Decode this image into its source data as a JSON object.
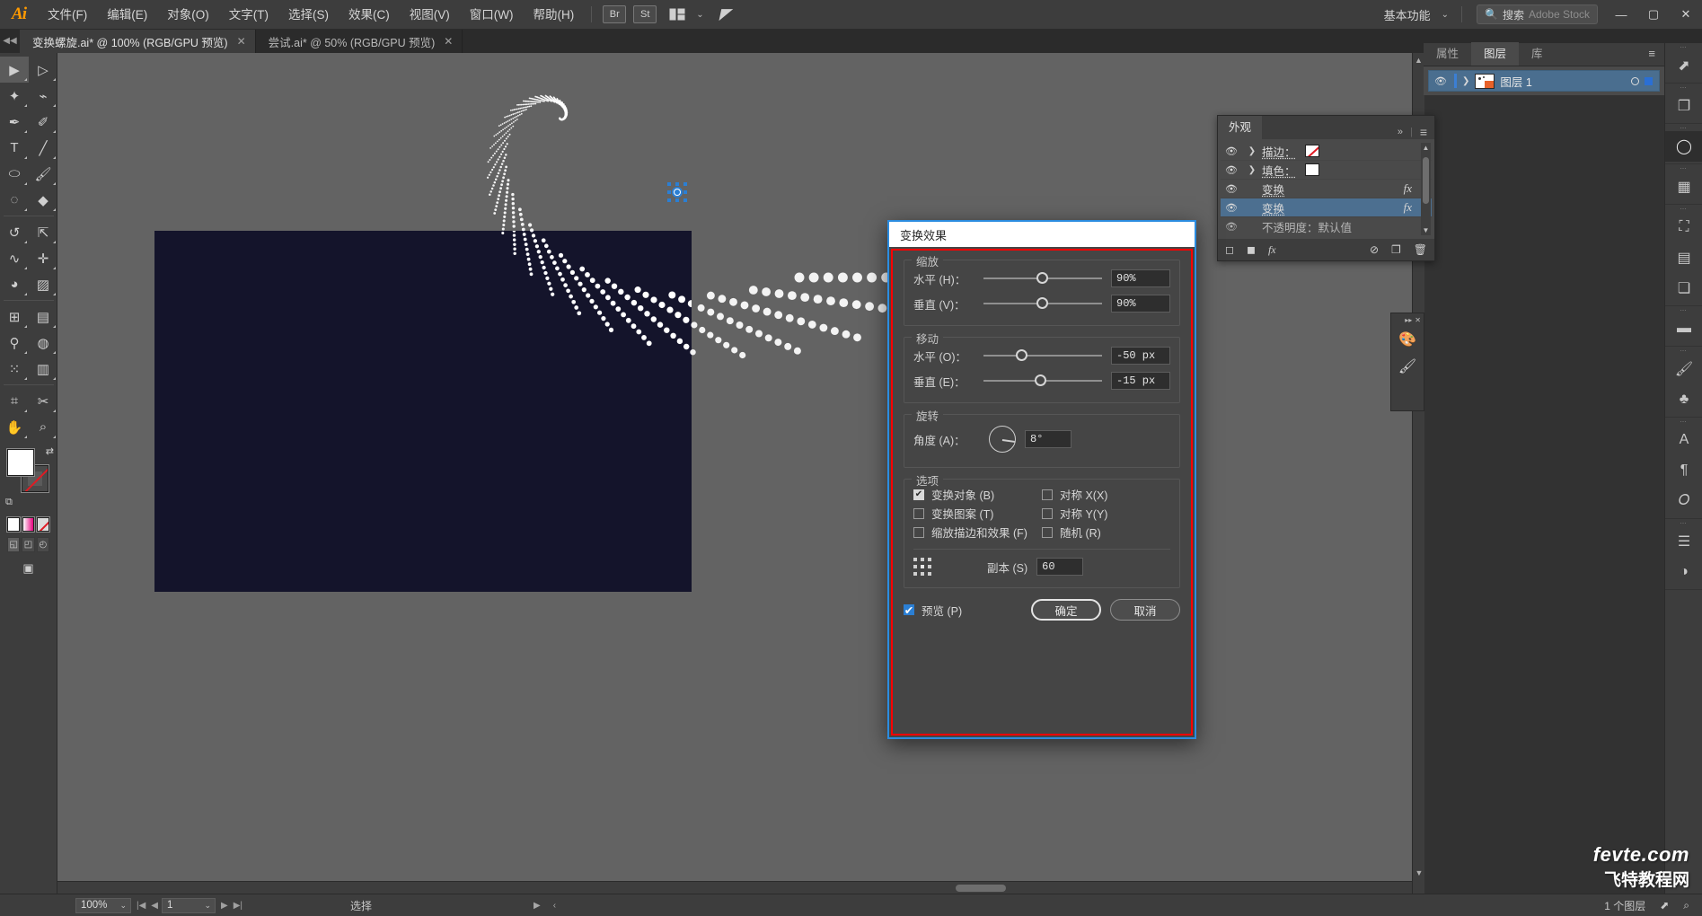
{
  "app": {
    "logo": "Ai",
    "workspace": "基本功能",
    "search_label": "搜索",
    "search_placeholder": "Adobe Stock"
  },
  "menubar": {
    "items": [
      {
        "label": "文件(F)"
      },
      {
        "label": "编辑(E)"
      },
      {
        "label": "对象(O)"
      },
      {
        "label": "文字(T)"
      },
      {
        "label": "选择(S)"
      },
      {
        "label": "效果(C)"
      },
      {
        "label": "视图(V)"
      },
      {
        "label": "窗口(W)"
      },
      {
        "label": "帮助(H)"
      }
    ],
    "bridge": "Br",
    "stock": "St"
  },
  "window_controls": {
    "minimize": "—",
    "maximize": "▢",
    "close": "✕"
  },
  "tabs": [
    {
      "label": "变换螺旋.ai* @ 100% (RGB/GPU 预览)",
      "active": true,
      "close": "✕"
    },
    {
      "label": "尝试.ai* @ 50% (RGB/GPU 预览)",
      "active": false,
      "close": "✕"
    }
  ],
  "appearance_panel": {
    "title": "外观",
    "collapse": "»",
    "menu": "≡",
    "rows": [
      {
        "label": "描边：",
        "swatch": "none",
        "has_caret": true,
        "fx": "",
        "selected": false
      },
      {
        "label": "填色：",
        "swatch": "white",
        "has_caret": true,
        "fx": "",
        "selected": false
      },
      {
        "label": "变换",
        "swatch": "",
        "has_caret": false,
        "fx": "fx",
        "selected": false
      },
      {
        "label": "变换",
        "swatch": "",
        "has_caret": false,
        "fx": "fx",
        "selected": true
      },
      {
        "label": "不透明度：默认值",
        "swatch": "",
        "has_caret": false,
        "fx": "",
        "selected": false
      }
    ],
    "footer_icons": [
      "new-stroke",
      "new-fill",
      "add-effect",
      "clear-appearance",
      "duplicate",
      "delete"
    ]
  },
  "layers_panel": {
    "tabs": [
      {
        "label": "属性",
        "active": false
      },
      {
        "label": "图层",
        "active": true
      },
      {
        "label": "库",
        "active": false
      }
    ],
    "menu": "≡",
    "rows": [
      {
        "name": "图层 1",
        "visible": true,
        "selected": true
      }
    ]
  },
  "dialog": {
    "title": "变换效果",
    "sections": {
      "scale": {
        "legend": "缩放",
        "fields": [
          {
            "label": "水平 (H)：",
            "value": "90%",
            "knob_pct": 45
          },
          {
            "label": "垂直 (V)：",
            "value": "90%",
            "knob_pct": 45
          }
        ]
      },
      "move": {
        "legend": "移动",
        "fields": [
          {
            "label": "水平 (O)：",
            "value": "-50 px",
            "knob_pct": 27
          },
          {
            "label": "垂直 (E)：",
            "value": "-15 px",
            "knob_pct": 43
          }
        ]
      },
      "rotate": {
        "legend": "旋转",
        "label": "角度 (A)：",
        "value": "8°",
        "angle_deg": 8
      },
      "options": {
        "legend": "选项",
        "left": [
          {
            "label": "变换对象 (B)",
            "checked": true
          },
          {
            "label": "变换图案 (T)",
            "checked": false
          },
          {
            "label": "缩放描边和效果 (F)",
            "checked": false
          }
        ],
        "right": [
          {
            "label": "对称 X(X)",
            "checked": false
          },
          {
            "label": "对称 Y(Y)",
            "checked": false
          },
          {
            "label": "随机 (R)",
            "checked": false
          }
        ],
        "copies_label": "副本 (S)",
        "copies_value": "60"
      }
    },
    "preview_label": "预览 (P)",
    "preview_checked": true,
    "ok_label": "确定",
    "cancel_label": "取消"
  },
  "statusbar": {
    "zoom": "100%",
    "zoom_caret": "⌄",
    "first_page": "|◀",
    "prev_page": "◀",
    "page": "1",
    "page_caret": "⌄",
    "next_page": "▶",
    "last_page": "▶|",
    "status_text": "选择",
    "status_caret": "▶",
    "status_back": "‹",
    "layers_count": "1 个图层",
    "export_icon": "⬈",
    "search_icon": "⌕"
  },
  "watermark": {
    "line1": "fevte.com",
    "line2": "飞特教程网"
  },
  "colors": {
    "accent_blue": "#2b8ce0",
    "dialog_outline_red": "#ff0000",
    "artboard_bg": "#14142b",
    "canvas_bg": "#636363",
    "panel_bg": "#3d3d3d",
    "selection_blue": "#4c6f90"
  }
}
